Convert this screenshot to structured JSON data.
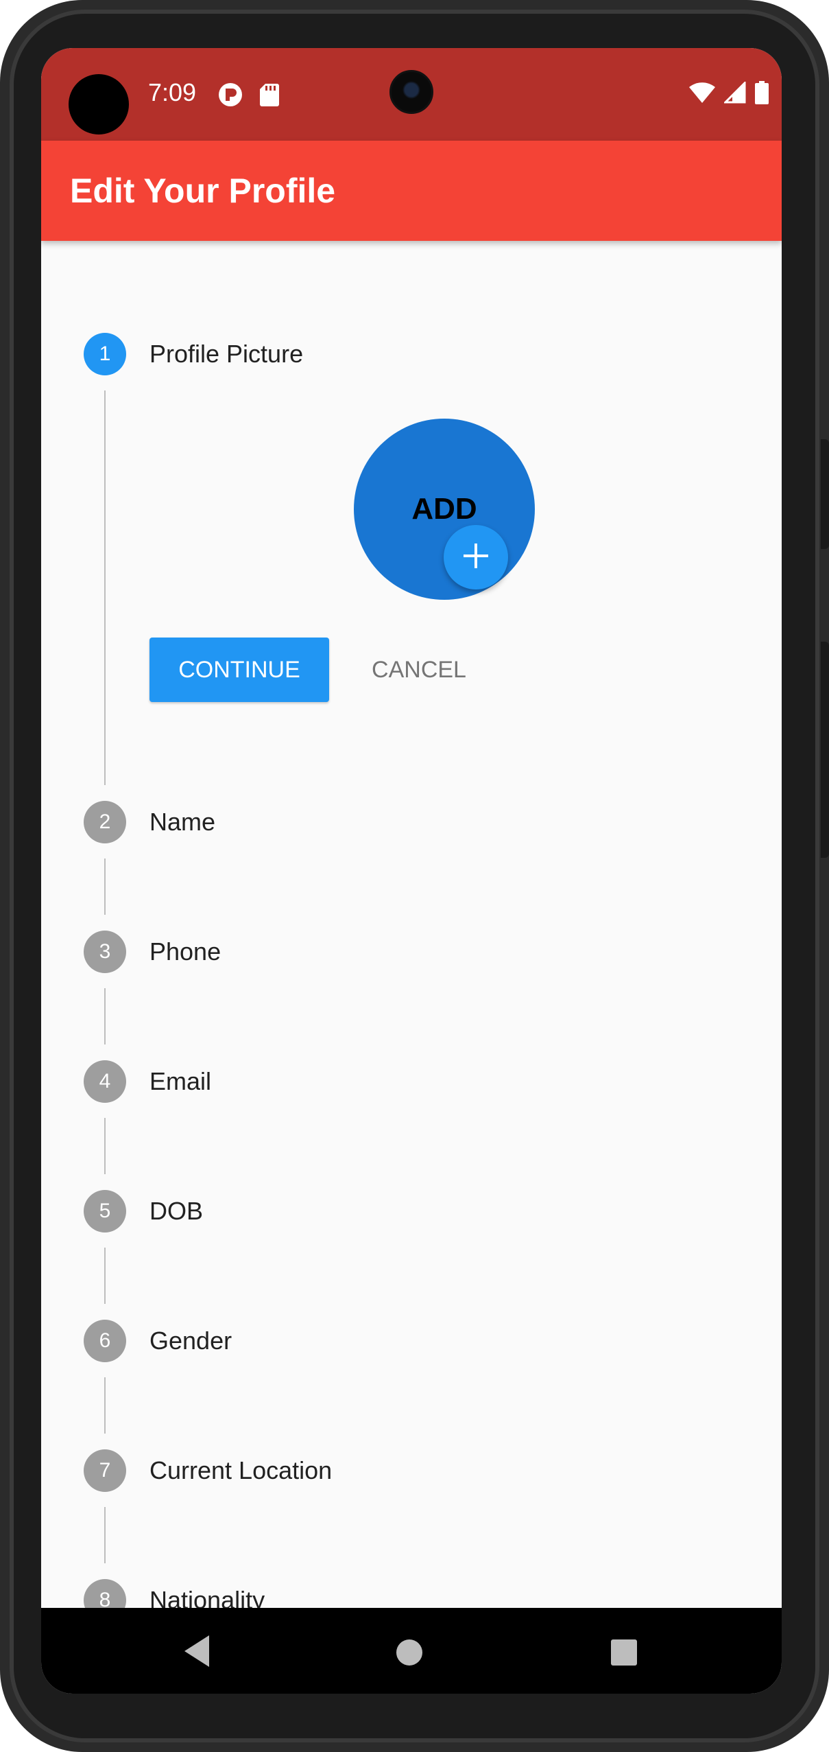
{
  "status_bar": {
    "time": "7:09",
    "color": "#b3302a"
  },
  "app_bar": {
    "title": "Edit Your Profile",
    "color": "#f44336"
  },
  "stepper": {
    "active_color": "#2196f3",
    "inactive_color": "#9e9e9e",
    "steps": [
      {
        "number": "1",
        "label": "Profile Picture"
      },
      {
        "number": "2",
        "label": "Name"
      },
      {
        "number": "3",
        "label": "Phone"
      },
      {
        "number": "4",
        "label": "Email"
      },
      {
        "number": "5",
        "label": "DOB"
      },
      {
        "number": "6",
        "label": "Gender"
      },
      {
        "number": "7",
        "label": "Current Location"
      },
      {
        "number": "8",
        "label": "Nationality"
      }
    ]
  },
  "profile_picture": {
    "avatar_text": "ADD",
    "add_icon": "plus-icon"
  },
  "actions": {
    "continue_label": "CONTINUE",
    "cancel_label": "CANCEL"
  },
  "nav_bar": {
    "back_icon": "back-triangle-icon",
    "home_icon": "home-circle-icon",
    "recents_icon": "recents-square-icon"
  }
}
